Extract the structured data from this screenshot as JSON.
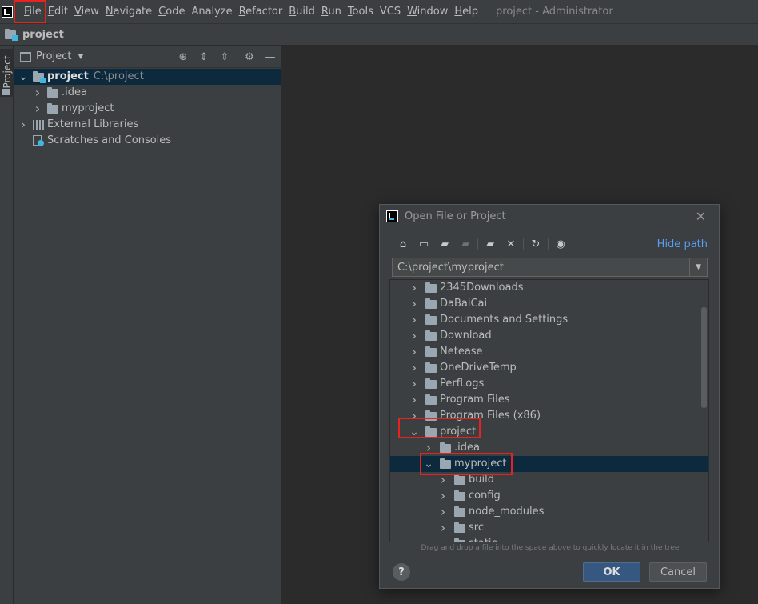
{
  "menubar": {
    "items": [
      {
        "mnemonic": "F",
        "rest": "ile"
      },
      {
        "mnemonic": "E",
        "rest": "dit"
      },
      {
        "mnemonic": "V",
        "rest": "iew"
      },
      {
        "mnemonic": "N",
        "rest": "avigate"
      },
      {
        "mnemonic": "C",
        "rest": "ode"
      },
      {
        "mnemonic": "",
        "rest": "Analyze"
      },
      {
        "mnemonic": "R",
        "rest": "efactor"
      },
      {
        "mnemonic": "B",
        "rest": "uild"
      },
      {
        "mnemonic": "R",
        "rest": "un"
      },
      {
        "mnemonic": "T",
        "rest": "ools"
      },
      {
        "mnemonic": "",
        "rest": "VCS"
      },
      {
        "mnemonic": "W",
        "rest": "indow"
      },
      {
        "mnemonic": "H",
        "rest": "elp"
      }
    ],
    "window_title": "project - Administrator"
  },
  "navbar": {
    "crumb": "project"
  },
  "toolstrip": {
    "tab_label": "Project"
  },
  "project_panel": {
    "title": "Project",
    "tree": [
      {
        "label": "project",
        "path": "C:\\project",
        "depth": 0,
        "expanded": true,
        "bold": true,
        "icon": "module-folder-icon"
      },
      {
        "label": ".idea",
        "depth": 1,
        "expanded": false,
        "icon": "folder-icon"
      },
      {
        "label": "myproject",
        "depth": 1,
        "expanded": false,
        "icon": "folder-icon"
      },
      {
        "label": "External Libraries",
        "depth": 0,
        "expanded": false,
        "icon": "library-icon"
      },
      {
        "label": "Scratches and Consoles",
        "depth": 0,
        "leaf": true,
        "icon": "scratch-icon"
      }
    ]
  },
  "dialog": {
    "title": "Open File or Project",
    "hide_path": "Hide path",
    "path_value": "C:\\project\\myproject",
    "hint": "Drag and drop a file into the space above to quickly locate it in the tree",
    "ok_label": "OK",
    "cancel_label": "Cancel",
    "help_label": "?",
    "tree": [
      {
        "label": "2345Downloads",
        "depth": 0,
        "expanded": false
      },
      {
        "label": "DaBaiCai",
        "depth": 0,
        "expanded": false
      },
      {
        "label": "Documents and Settings",
        "depth": 0,
        "expanded": false
      },
      {
        "label": "Download",
        "depth": 0,
        "expanded": false
      },
      {
        "label": "Netease",
        "depth": 0,
        "expanded": false
      },
      {
        "label": "OneDriveTemp",
        "depth": 0,
        "expanded": false
      },
      {
        "label": "PerfLogs",
        "depth": 0,
        "expanded": false
      },
      {
        "label": "Program Files",
        "depth": 0,
        "expanded": false
      },
      {
        "label": "Program Files (x86)",
        "depth": 0,
        "expanded": false
      },
      {
        "label": "project",
        "depth": 0,
        "expanded": true
      },
      {
        "label": ".idea",
        "depth": 1,
        "expanded": false
      },
      {
        "label": "myproject",
        "depth": 1,
        "expanded": true,
        "selected": true
      },
      {
        "label": "build",
        "depth": 2,
        "expanded": false
      },
      {
        "label": "config",
        "depth": 2,
        "expanded": false
      },
      {
        "label": "node_modules",
        "depth": 2,
        "expanded": false
      },
      {
        "label": "src",
        "depth": 2,
        "expanded": false
      },
      {
        "label": "static",
        "depth": 2,
        "expanded": false
      }
    ]
  },
  "colors": {
    "accent": "#589df6",
    "selection": "#0d293e",
    "highlight": "#e8231e"
  }
}
